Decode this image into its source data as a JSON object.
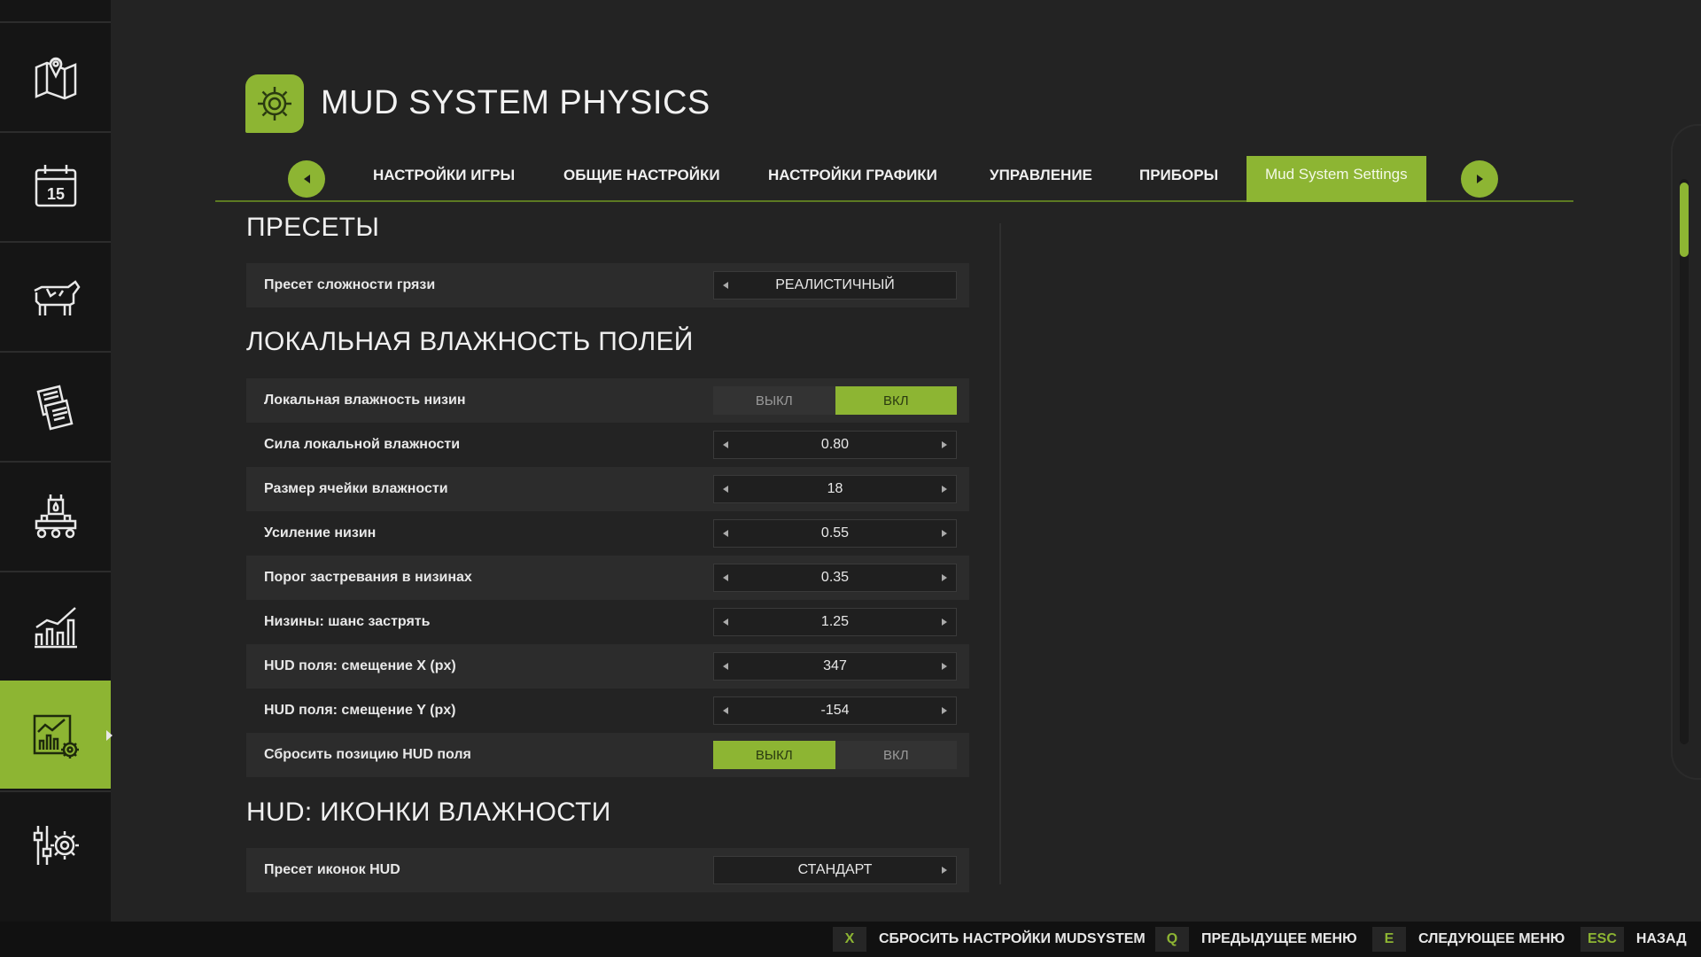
{
  "header": {
    "title": "MUD SYSTEM PHYSICS",
    "icon": "gear-icon"
  },
  "sidebar": {
    "items": [
      {
        "icon": "map-icon",
        "active": false
      },
      {
        "icon": "calendar-icon",
        "label": "15",
        "active": false
      },
      {
        "icon": "cow-icon",
        "active": false
      },
      {
        "icon": "contracts-icon",
        "active": false
      },
      {
        "icon": "production-icon",
        "active": false
      },
      {
        "icon": "statistics-icon",
        "active": false
      },
      {
        "icon": "chart-settings-icon",
        "active": true
      },
      {
        "icon": "sliders-gear-icon",
        "active": false
      }
    ]
  },
  "tabs": [
    {
      "label": "НАСТРОЙКИ ИГРЫ",
      "active": false
    },
    {
      "label": "ОБЩИЕ НАСТРОЙКИ",
      "active": false
    },
    {
      "label": "НАСТРОЙКИ ГРАФИКИ",
      "active": false
    },
    {
      "label": "УПРАВЛЕНИЕ",
      "active": false
    },
    {
      "label": "ПРИБОРЫ",
      "active": false
    },
    {
      "label": "Mud System Settings",
      "active": true
    }
  ],
  "sections": [
    {
      "title": "ПРЕСЕТЫ",
      "rows": [
        {
          "label": "Пресет сложности грязи",
          "type": "select",
          "value": "РЕАЛИСТИЧНЫЙ",
          "left_arrow": true,
          "right_arrow": false
        }
      ]
    },
    {
      "title": "ЛОКАЛЬНАЯ ВЛАЖНОСТЬ ПОЛЕЙ",
      "rows": [
        {
          "label": "Локальная влажность низин",
          "type": "toggle",
          "off_label": "ВЫКЛ",
          "on_label": "ВКЛ",
          "value": "ВКЛ"
        },
        {
          "label": "Сила локальной влажности",
          "type": "select",
          "value": "0.80",
          "left_arrow": true,
          "right_arrow": true
        },
        {
          "label": "Размер ячейки влажности",
          "type": "select",
          "value": "18",
          "left_arrow": true,
          "right_arrow": true
        },
        {
          "label": "Усиление низин",
          "type": "select",
          "value": "0.55",
          "left_arrow": true,
          "right_arrow": true
        },
        {
          "label": "Порог застревания в низинах",
          "type": "select",
          "value": "0.35",
          "left_arrow": true,
          "right_arrow": true
        },
        {
          "label": "Низины: шанс застрять",
          "type": "select",
          "value": "1.25",
          "left_arrow": true,
          "right_arrow": true
        },
        {
          "label": "HUD поля: смещение X (px)",
          "type": "select",
          "value": "347",
          "left_arrow": true,
          "right_arrow": true
        },
        {
          "label": "HUD поля: смещение Y (px)",
          "type": "select",
          "value": "-154",
          "left_arrow": true,
          "right_arrow": true
        },
        {
          "label": "Сбросить позицию HUD поля",
          "type": "toggle",
          "off_label": "ВЫКЛ",
          "on_label": "ВКЛ",
          "value": "ВЫКЛ"
        }
      ]
    },
    {
      "title": "HUD: ИКОНКИ ВЛАЖНОСТИ",
      "rows": [
        {
          "label": "Пресет иконок HUD",
          "type": "select",
          "value": "СТАНДАРТ",
          "left_arrow": false,
          "right_arrow": true
        }
      ]
    }
  ],
  "footer": {
    "hints": [
      {
        "key": "X",
        "label": "СБРОСИТЬ НАСТРОЙКИ MUDSYSTEM"
      },
      {
        "key": "Q",
        "label": "ПРЕДЫДУЩЕЕ МЕНЮ"
      },
      {
        "key": "E",
        "label": "СЛЕДУЮЩЕЕ МЕНЮ"
      },
      {
        "key": "ESC",
        "label": "НАЗАД"
      }
    ]
  },
  "colors": {
    "accent": "#8db533",
    "background": "#232323",
    "sidebar": "#151515"
  }
}
